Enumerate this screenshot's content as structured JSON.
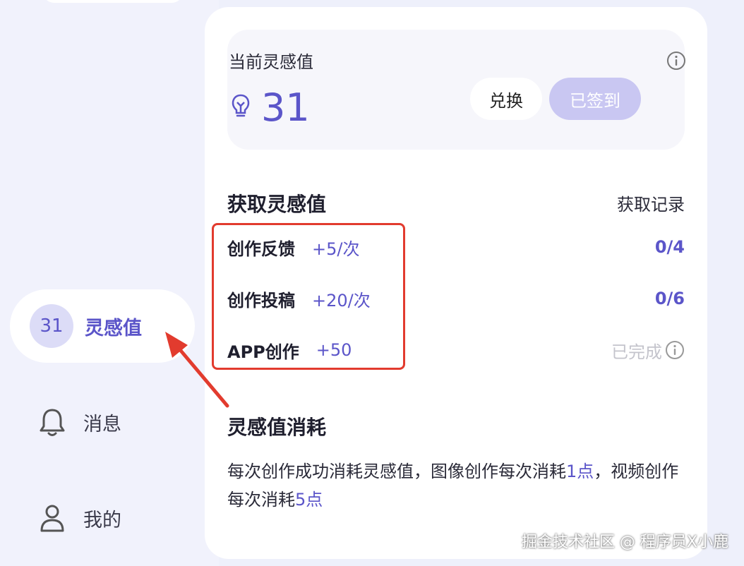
{
  "sidebar": {
    "inspiration": {
      "count": "31",
      "label": "灵感值"
    },
    "messages": {
      "label": "消息"
    },
    "profile": {
      "label": "我的"
    }
  },
  "balance": {
    "title": "当前灵感值",
    "value": "31",
    "exchange_label": "兑换",
    "signed_label": "已签到"
  },
  "earn": {
    "title": "获取灵感值",
    "history_label": "获取记录",
    "tasks": [
      {
        "name": "创作反馈",
        "reward": "+5/次",
        "progress": "0/4"
      },
      {
        "name": "创作投稿",
        "reward": "+20/次",
        "progress": "0/6"
      },
      {
        "name": "APP创作",
        "reward": "+50",
        "status": "已完成"
      }
    ]
  },
  "consume": {
    "title": "灵感值消耗",
    "text_1": "每次创作成功消耗灵感值，图像创作每次消耗",
    "image_cost": "1点",
    "text_2": "，视频创作每次消耗",
    "video_cost": "5点"
  },
  "watermark": "掘金技术社区 @ 程序员X小鹿",
  "colors": {
    "accent": "#5b55c9",
    "highlight": "#e23b2e",
    "background": "#eef0fb"
  },
  "icons": [
    "info-icon",
    "lightbulb-icon",
    "bell-icon",
    "user-icon",
    "arrow-annotation"
  ]
}
